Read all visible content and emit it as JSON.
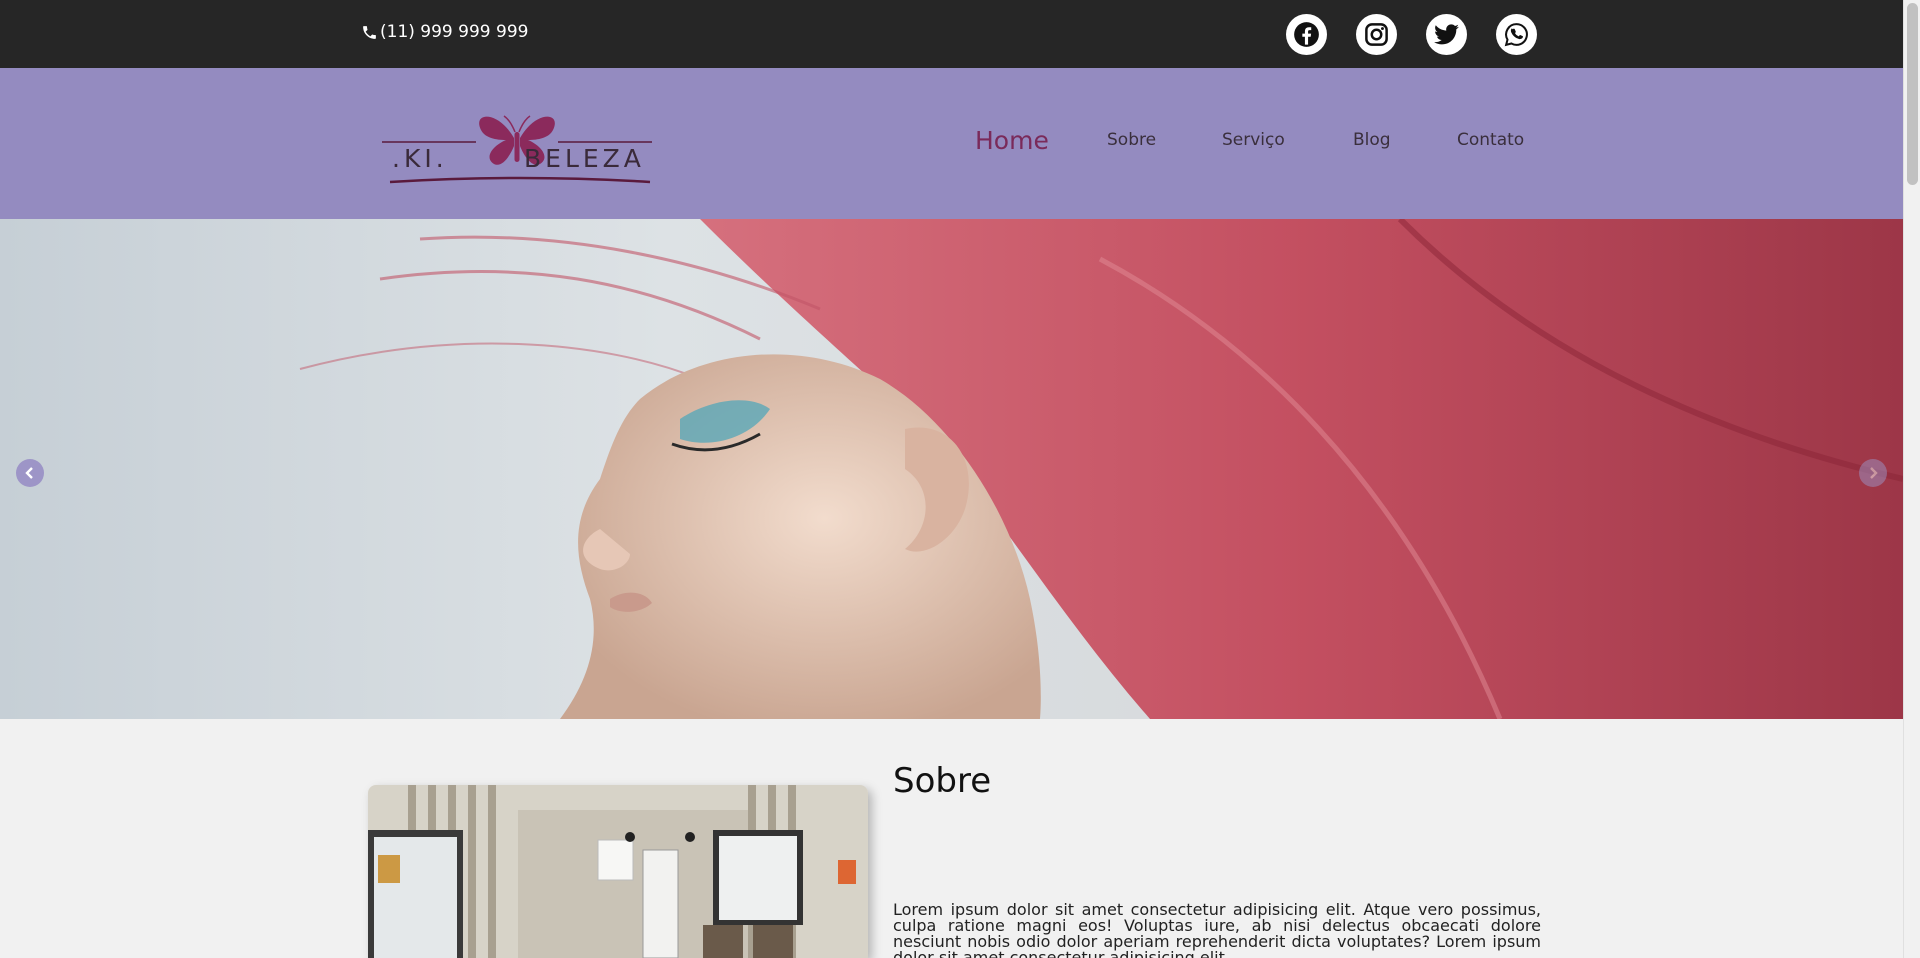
{
  "topbar": {
    "phone": "(11) 999 999 999",
    "social_icons": [
      "facebook-icon",
      "instagram-icon",
      "twitter-icon",
      "whatsapp-icon"
    ]
  },
  "brand": {
    "logo_left": ".KI.",
    "logo_right": "BELEZA",
    "accent_color": "#8b2a5c"
  },
  "nav": {
    "items": [
      {
        "label": "Home",
        "active": true
      },
      {
        "label": "Sobre",
        "active": false
      },
      {
        "label": "Serviço",
        "active": false
      },
      {
        "label": "Blog",
        "active": false
      },
      {
        "label": "Contato",
        "active": false
      }
    ]
  },
  "hero": {
    "prev_icon": "chevron-left-icon",
    "next_icon": "chevron-right-icon"
  },
  "about": {
    "title": "Sobre",
    "text": "Lorem ipsum dolor sit amet consectetur adipisicing elit. Atque vero possimus, culpa ratione magni eos! Voluptas iure, ab nisi delectus obcaecati dolore nesciunt nobis odio dolor aperiam reprehenderit dicta voluptates? Lorem ipsum dolor sit amet consectetur adipisicing elit."
  },
  "colors": {
    "topbar": "#262626",
    "navbar": "#948bc0",
    "active_nav": "#7a2a5a"
  }
}
